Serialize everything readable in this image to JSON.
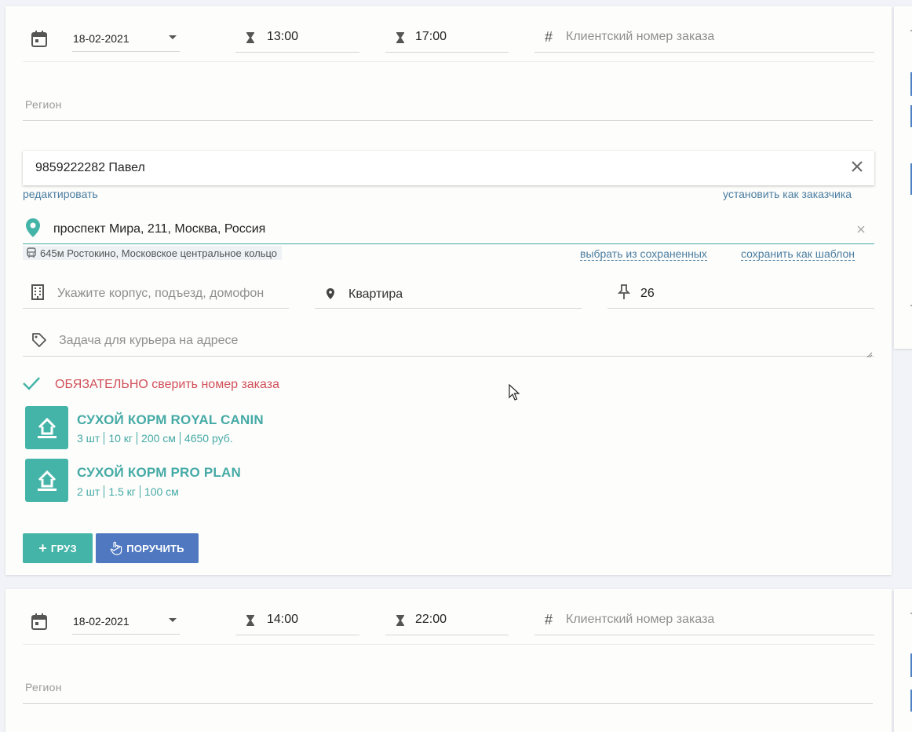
{
  "orders": [
    {
      "date": "18-02-2021",
      "time_from": "13:00",
      "time_to": "17:00",
      "client_order_placeholder": "Клиентский номер заказа",
      "region_placeholder": "Регион",
      "contact": "9859222282 Павел",
      "edit_link": "редактировать",
      "set_customer_link": "установить как заказчика",
      "address": "проспект Мира, 211, Москва, Россия",
      "station": "645м Ростокино, Московское центральное кольцо",
      "choose_saved_link": "выбрать из сохраненных",
      "save_template_link": "сохранить как шаблон",
      "building_placeholder": "Укажите корпус, подъезд, домофон",
      "apartment_placeholder": "Квартира",
      "floor_value": "26",
      "task_placeholder": "Задача для курьера на адресе",
      "check_note": "ОБЯЗАТЕЛЬНО сверить номер заказа",
      "cargo": [
        {
          "title": "СУХОЙ КОРМ ROYAL CANIN",
          "meta": [
            "3 шт",
            "10 кг",
            "200 см",
            "4650 руб."
          ]
        },
        {
          "title": "СУХОЙ КОРМ PRO PLAN",
          "meta": [
            "2 шт",
            "1.5 кг",
            "100 см"
          ]
        }
      ],
      "add_cargo_label": "ГРУЗ",
      "assign_label": "ПОРУЧИТЬ"
    },
    {
      "date": "18-02-2021",
      "time_from": "14:00",
      "time_to": "22:00",
      "client_order_placeholder": "Клиентский номер заказа",
      "region_placeholder": "Регион"
    }
  ],
  "colors": {
    "teal": "#45b4a8",
    "blue": "#4f78c1",
    "link": "#4a7da1",
    "alert": "#d0505a"
  },
  "icons": [
    "calendar-icon",
    "hourglass-icon",
    "hash-icon",
    "close-icon",
    "location-pin-icon",
    "bus-icon",
    "building-icon",
    "map-marker-icon",
    "pushpin-icon",
    "tag-icon",
    "check-icon",
    "upload-icon",
    "plus-icon",
    "hand-pointer-icon"
  ]
}
